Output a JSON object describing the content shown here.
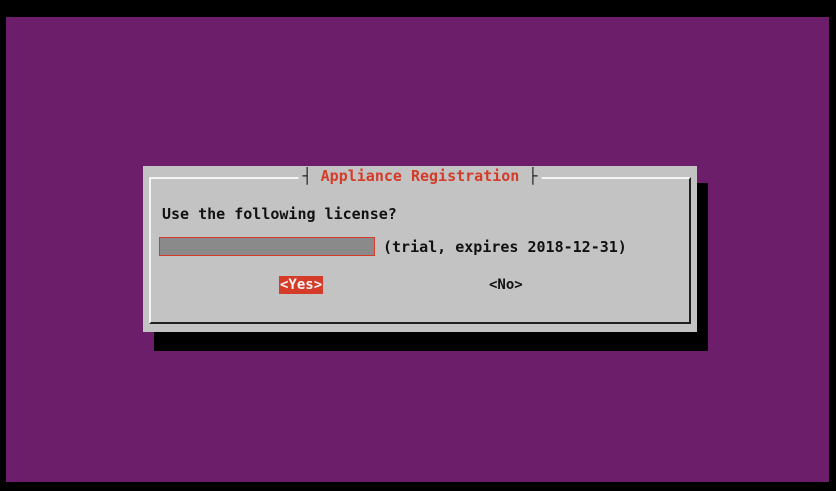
{
  "dialog": {
    "title": "Appliance Registration",
    "prompt": "Use the following license?",
    "license_note": "(trial, expires 2018-12-31)",
    "buttons": {
      "yes_label": "<Yes>",
      "no_label": "<No>"
    }
  },
  "colors": {
    "background": "#6c1e6a",
    "dialog_bg": "#c3c3c3",
    "accent": "#d43b28",
    "shadow": "#000000"
  }
}
